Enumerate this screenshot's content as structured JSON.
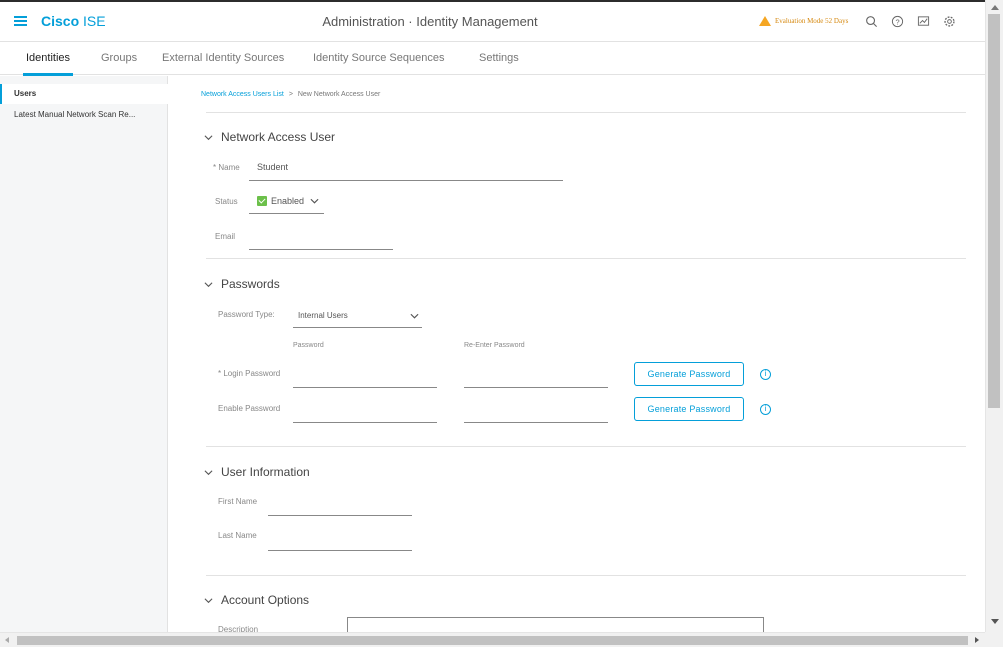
{
  "header": {
    "brand_bold": "Cisco",
    "brand_rest": "ISE",
    "title": "Administration · Identity Management",
    "evaluation": "Evaluation Mode 52 Days",
    "icons": [
      "search-icon",
      "help-icon",
      "dashboard-icon",
      "settings-icon"
    ]
  },
  "tabs": [
    {
      "label": "Identities",
      "active": true
    },
    {
      "label": "Groups"
    },
    {
      "label": "External Identity Sources"
    },
    {
      "label": "Identity Source Sequences"
    },
    {
      "label": "Settings"
    }
  ],
  "sidebar": {
    "items": [
      {
        "label": "Users",
        "active": true
      },
      {
        "label": "Latest Manual Network Scan Re..."
      }
    ]
  },
  "breadcrumb": {
    "link": "Network Access Users List",
    "separator": ">",
    "current": "New Network Access User"
  },
  "network_access_user": {
    "heading": "Network Access User",
    "name_label": "* Name",
    "name_value": "Student",
    "status_label": "Status",
    "status_value": "Enabled",
    "email_label": "Email",
    "email_value": ""
  },
  "passwords": {
    "heading": "Passwords",
    "type_label": "Password Type:",
    "type_value": "Internal Users",
    "col_password": "Password",
    "col_reenter": "Re-Enter Password",
    "login_label": "* Login Password",
    "enable_label": "Enable Password",
    "generate_label": "Generate Password"
  },
  "user_information": {
    "heading": "User Information",
    "first_name_label": "First Name",
    "last_name_label": "Last Name"
  },
  "account_options": {
    "heading": "Account Options",
    "description_label": "Description"
  },
  "colors": {
    "accent": "#049fd9",
    "warning": "#f5a623",
    "check": "#6cc04a"
  }
}
